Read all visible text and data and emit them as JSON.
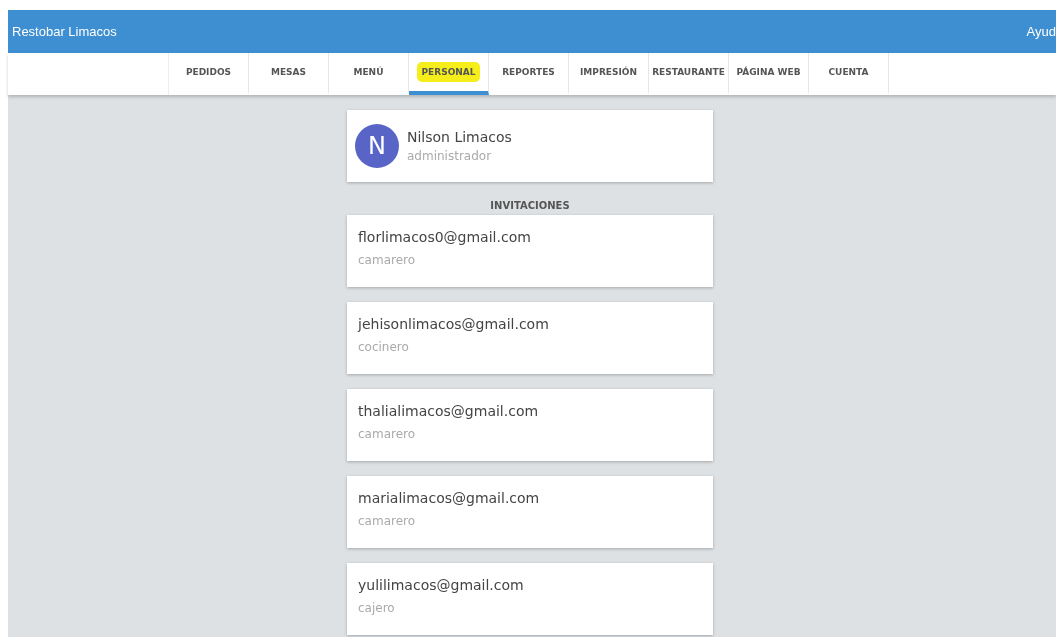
{
  "header": {
    "title": "Restobar Limacos",
    "help_link": "Ayud"
  },
  "tabs": [
    {
      "label": "PEDIDOS",
      "selected": false
    },
    {
      "label": "MESAS",
      "selected": false
    },
    {
      "label": "MENÚ",
      "selected": false
    },
    {
      "label": "PERSONAL",
      "selected": true
    },
    {
      "label": "REPORTES",
      "selected": false
    },
    {
      "label": "IMPRESIÓN",
      "selected": false
    },
    {
      "label": "RESTAURANTE",
      "selected": false
    },
    {
      "label": "PÁGINA WEB",
      "selected": false
    },
    {
      "label": "CUENTA",
      "selected": false
    }
  ],
  "profile": {
    "initial": "N",
    "name": "Nilson Limacos",
    "role": "administrador"
  },
  "invitations": {
    "heading": "INVITACIONES",
    "items": [
      {
        "email": "florlimacos0@gmail.com",
        "role": "camarero"
      },
      {
        "email": "jehisonlimacos@gmail.com",
        "role": "cocinero"
      },
      {
        "email": "thalialimacos@gmail.com",
        "role": "camarero"
      },
      {
        "email": "marialimacos@gmail.com",
        "role": "camarero"
      },
      {
        "email": "yulilimacos@gmail.com",
        "role": "cajero"
      }
    ]
  }
}
